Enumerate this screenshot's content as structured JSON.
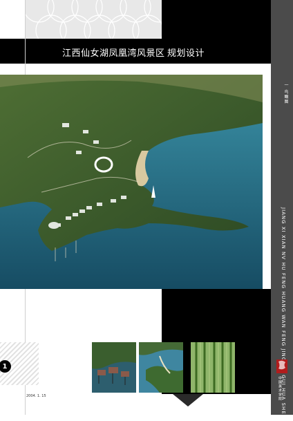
{
  "header": {
    "title": "江西仙女湖凤凰湾风景区",
    "subtitle": "规划设计"
  },
  "sidebar": {
    "section_label": "一 鸟瞰图",
    "pinyin": "JIANG XI XIAN NV HU FENG HUANG WAN FENG JING QU GUI HUA SHE JI",
    "organization": "中国美术学院"
  },
  "page": {
    "number": "1",
    "date": "2004. 1. 15"
  },
  "colors": {
    "black": "#000000",
    "sidebar": "#4b4b4b",
    "water": "#2c6a86",
    "logo_red": "#b11c1c"
  },
  "images": [
    {
      "name": "aerial-rendering",
      "description": "aerial"
    },
    {
      "name": "photo-village",
      "description": "village"
    },
    {
      "name": "photo-lake",
      "description": "lake"
    },
    {
      "name": "photo-bamboo",
      "description": "bamboo"
    }
  ]
}
